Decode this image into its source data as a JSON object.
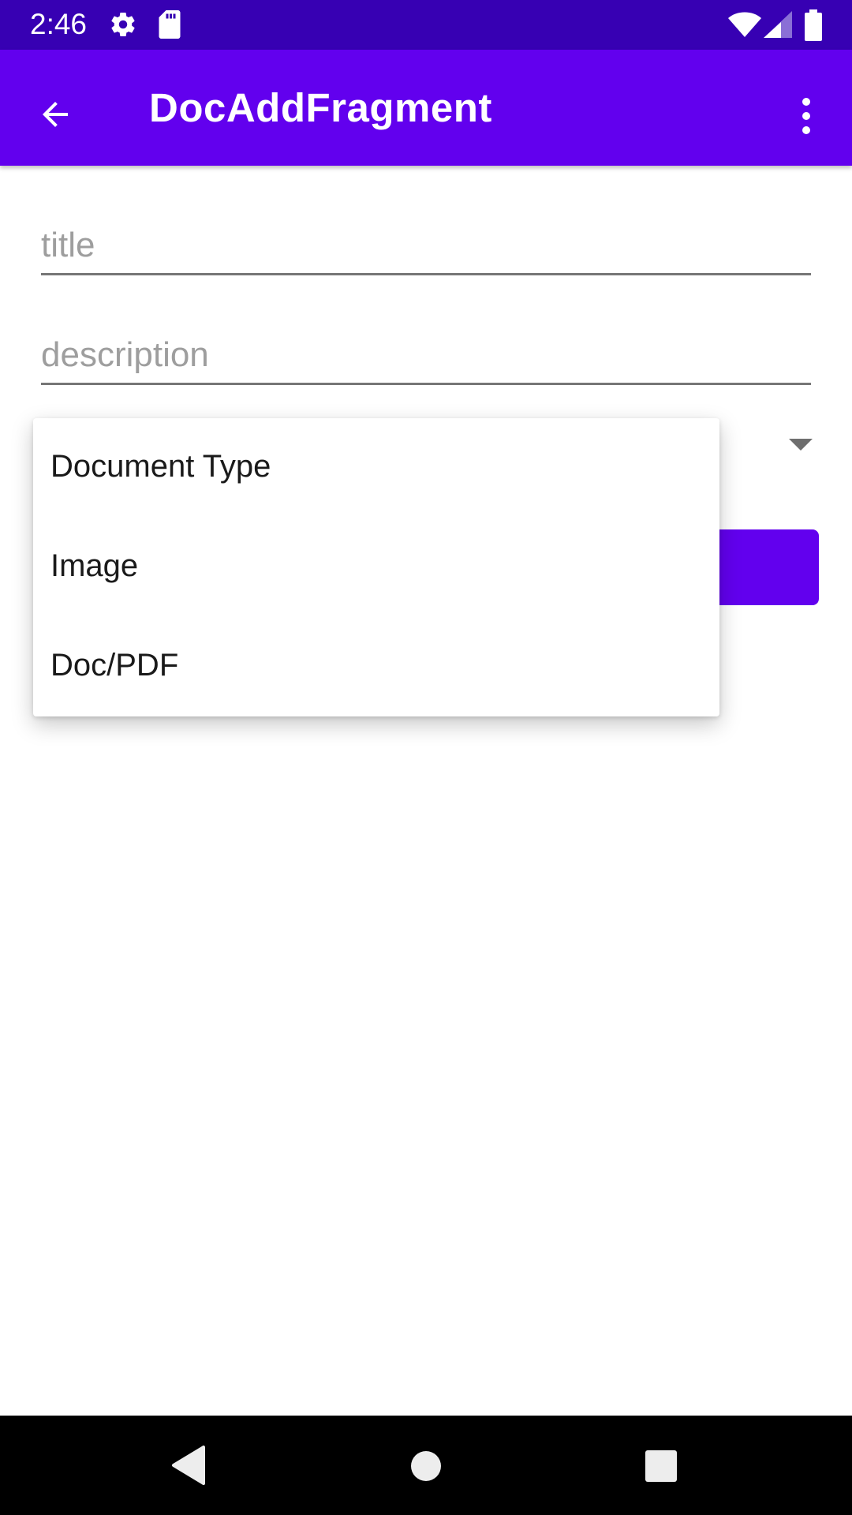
{
  "status_bar": {
    "time": "2:46",
    "icons": [
      "gear-icon",
      "sd-card-icon",
      "wifi-icon",
      "signal-icon",
      "battery-icon"
    ],
    "background": "#3700b3"
  },
  "app_bar": {
    "title": "DocAddFragment",
    "background": "#6200ee",
    "icons": {
      "back": "arrow-back-icon",
      "overflow": "more-vert-icon"
    }
  },
  "form": {
    "title_field": {
      "value": "",
      "placeholder": "title"
    },
    "description_field": {
      "value": "",
      "placeholder": "description"
    },
    "type_spinner": {
      "open": true
    }
  },
  "dropdown": {
    "items": [
      {
        "label": "Document Type"
      },
      {
        "label": "Image"
      },
      {
        "label": "Doc/PDF"
      }
    ]
  },
  "nav_bar": {
    "icons": [
      "nav-back-icon",
      "nav-home-icon",
      "nav-recents-icon"
    ]
  },
  "colors": {
    "primary": "#6200ee",
    "primary_dark": "#3700b3",
    "hint": "#9e9e9e"
  }
}
